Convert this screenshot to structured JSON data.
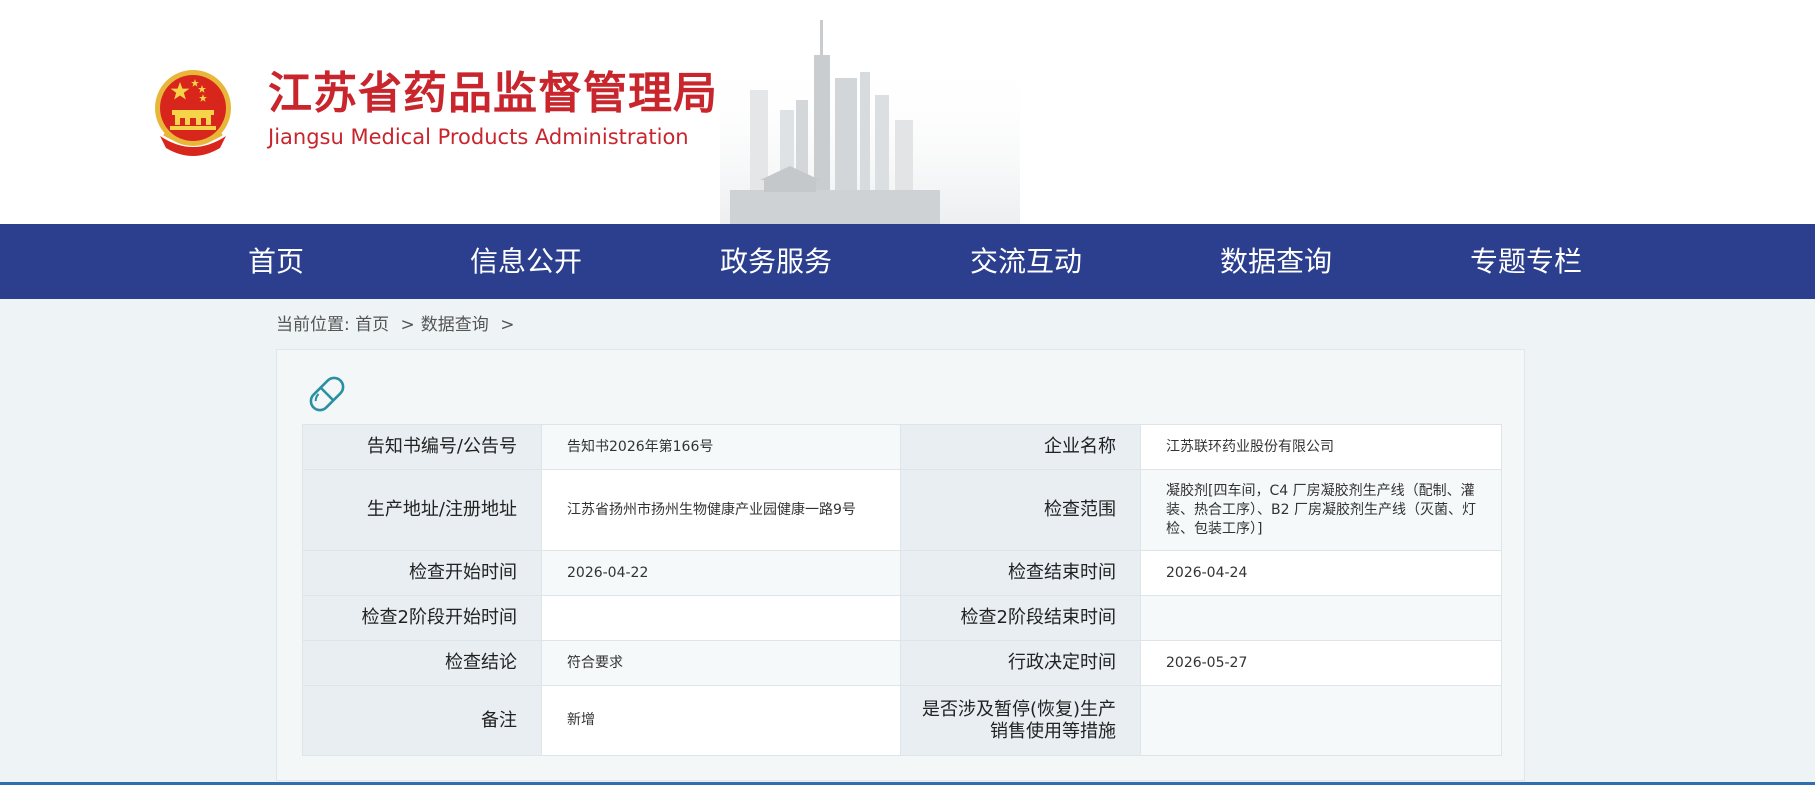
{
  "header": {
    "title_cn": "江苏省药品监督管理局",
    "title_en": "Jiangsu Medical Products Administration",
    "emblem_icon": "national-emblem-icon"
  },
  "nav": {
    "items": [
      {
        "label": "首页"
      },
      {
        "label": "信息公开"
      },
      {
        "label": "政务服务"
      },
      {
        "label": "交流互动"
      },
      {
        "label": "数据查询"
      },
      {
        "label": "专题专栏"
      }
    ]
  },
  "breadcrumb": {
    "prefix": "当前位置:",
    "items": [
      {
        "label": "首页"
      },
      {
        "label": "数据查询"
      }
    ],
    "separator": ">"
  },
  "detail": {
    "icon": "pill-capsule-icon",
    "rows": [
      {
        "label1": "告知书编号/公告号",
        "value1": "告知书2026年第166号",
        "label2": "企业名称",
        "value2": "江苏联环药业股份有限公司"
      },
      {
        "label1": "生产地址/注册地址",
        "value1": "江苏省扬州市扬州生物健康产业园健康一路9号",
        "label2": "检查范围",
        "value2": "凝胶剂[四车间，C4 厂房凝胶剂生产线（配制、灌装、热合工序）、B2 厂房凝胶剂生产线（灭菌、灯检、包装工序）]"
      },
      {
        "label1": "检查开始时间",
        "value1": "2026-04-22",
        "label2": "检查结束时间",
        "value2": "2026-04-24"
      },
      {
        "label1": "检查2阶段开始时间",
        "value1": "",
        "label2": "检查2阶段结束时间",
        "value2": ""
      },
      {
        "label1": "检查结论",
        "value1": "符合要求",
        "label2": "行政决定时间",
        "value2": "2026-05-27"
      },
      {
        "label1": "备注",
        "value1": "新增",
        "label2": "是否涉及暂停(恢复)生产销售使用等措施",
        "value2": ""
      }
    ]
  },
  "colors": {
    "brand_red": "#c8252d",
    "nav_blue": "#2b3f8e",
    "content_bg": "#eef3f5",
    "pill_teal": "#2a8fa3"
  }
}
